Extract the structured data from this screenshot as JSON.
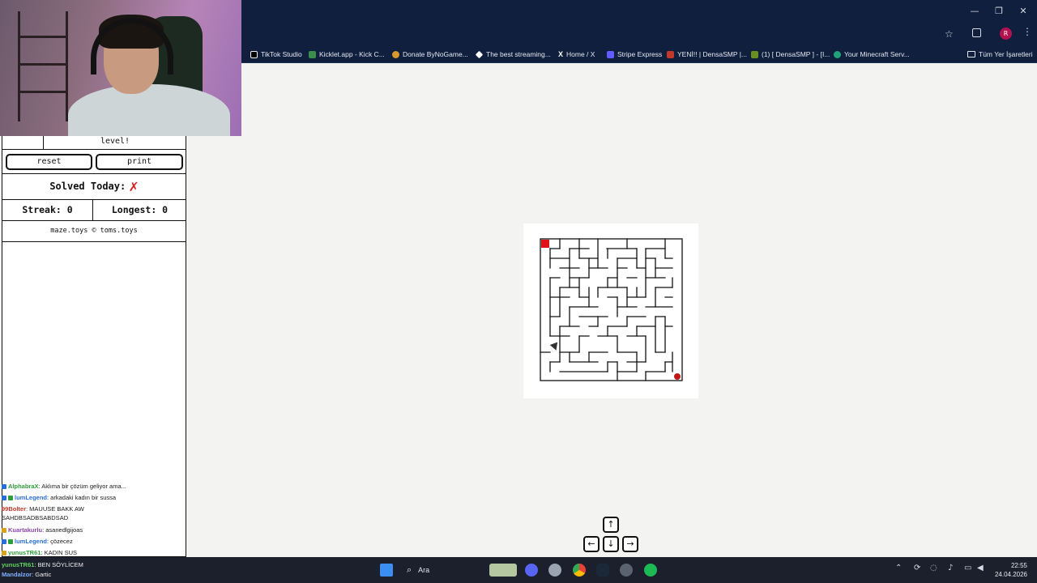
{
  "browser": {
    "bookmarks": [
      {
        "label": "TikTok Studio",
        "color": "#000000"
      },
      {
        "label": "Kicklet.app - Kick C...",
        "color": "#3b8d4e"
      },
      {
        "label": "Donate ByNoGame...",
        "color": "#d69a2d"
      },
      {
        "label": "The best streaming...",
        "color": "#ffffff"
      },
      {
        "label": "Home / X",
        "color": "#000000"
      },
      {
        "label": "Stripe Express",
        "color": "#635bff"
      },
      {
        "label": "YENİ!! | DensaSMP |...",
        "color": "#c0392b"
      },
      {
        "label": "(1) [ DensaSMP ] - [I...",
        "color": "#6b8e23"
      },
      {
        "label": "Your Minecraft Serv...",
        "color": "#1fa37a"
      }
    ],
    "bookmarks_folder": "Tüm Yer İşaretleri",
    "profile_initial": "R"
  },
  "panel": {
    "level_text": "level!",
    "reset_label": "reset",
    "print_label": "print",
    "solved_label": "Solved Today:",
    "solved_mark": "✗",
    "streak_label": "Streak: 0",
    "longest_label": "Longest: 0",
    "credit": "maze.toys © toms.toys"
  },
  "chat": [
    {
      "user": "AlphabraX",
      "message": ": Aklıma bir çözüm geliyor ama...",
      "color": "#2e9e3a"
    },
    {
      "user": "lumLegend",
      "message": ": arkadaki kadın bir sussa",
      "color": "#2a6fd6"
    },
    {
      "user": "99Bolter",
      "message": ": MAUUSE BAKK AW",
      "color": "#c0392b"
    },
    {
      "user": "",
      "message": "SAHDBSADBSABDSAD",
      "color": "#1a1a1a"
    },
    {
      "user": "Kuartakurlu",
      "message": ": asanedlgijoas",
      "color": "#8e44ad"
    },
    {
      "user": "lumLegend",
      "message": ": çözecez",
      "color": "#2a6fd6"
    },
    {
      "user": "yunusTR61",
      "message": ": KADIN SUS",
      "color": "#2e9e3a"
    }
  ],
  "bottom_chat": [
    {
      "user": "yunusTR61",
      "message": ": BEN SÖYLİCEM"
    },
    {
      "user": "Mandalzor",
      "message": ": Gartic"
    }
  ],
  "keys": {
    "up": "↑",
    "left": "←",
    "down": "↓",
    "right": "→"
  },
  "taskbar": {
    "search_placeholder": "Ara",
    "time": "22:55",
    "date": "24.04.2026"
  }
}
